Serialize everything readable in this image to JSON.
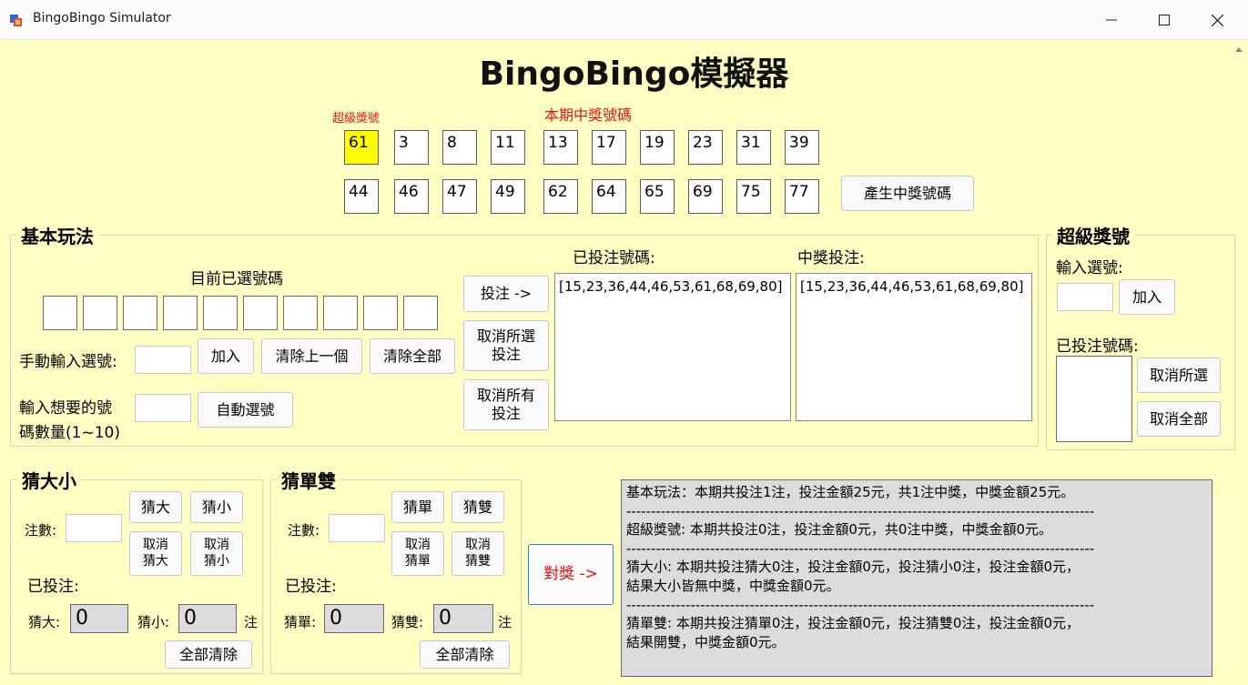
{
  "window": {
    "title": "BingoBingo Simulator"
  },
  "heading": "BingoBingo模擬器",
  "draw": {
    "super_label": "超級獎號",
    "winning_label": "本期中獎號碼",
    "super_number": "61",
    "row1": [
      "3",
      "8",
      "11",
      "13",
      "17",
      "19",
      "23",
      "31",
      "39"
    ],
    "row2": [
      "44",
      "46",
      "47",
      "49",
      "62",
      "64",
      "65",
      "69",
      "75",
      "77"
    ],
    "generate_button": "產生中獎號碼"
  },
  "basic": {
    "group_label": "基本玩法",
    "selected_label": "目前已選號碼",
    "manual_label": "手動輸入選號:",
    "add_button": "加入",
    "clear_last_button": "清除上一個",
    "clear_all_button": "清除全部",
    "count_label_line1": "輸入想要的號",
    "count_label_line2": "碼數量(1~10)",
    "auto_button": "自動選號",
    "bet_button": "投注 ->",
    "cancel_selected_line1": "取消所選",
    "cancel_selected_line2": "投注",
    "cancel_all_line1": "取消所有",
    "cancel_all_line2": "投注",
    "placed_label": "已投注號碼:",
    "placed_item": "[15,23,36,44,46,53,61,68,69,80]",
    "winning_bets_label": "中獎投注:",
    "winning_item": "[15,23,36,44,46,53,61,68,69,80]"
  },
  "super": {
    "group_label": "超級獎號",
    "input_label": "輸入選號:",
    "add_button": "加入",
    "placed_label": "已投注號碼:",
    "cancel_selected_button": "取消所選",
    "cancel_all_button": "取消全部"
  },
  "bigsmall": {
    "group_label": "猜大小",
    "count_label": "注數:",
    "big_button": "猜大",
    "small_button": "猜小",
    "cancel_big_line1": "取消",
    "cancel_big_line2": "猜大",
    "cancel_small_line1": "取消",
    "cancel_small_line2": "猜小",
    "placed_label": "已投注:",
    "big_label": "猜大:",
    "big_value": "0",
    "small_label": "猜小:",
    "small_value": "0",
    "unit": "注",
    "clear_all_button": "全部清除"
  },
  "oddeven": {
    "group_label": "猜單雙",
    "count_label": "注數:",
    "odd_button": "猜單",
    "even_button": "猜雙",
    "cancel_odd_line1": "取消",
    "cancel_odd_line2": "猜單",
    "cancel_even_line1": "取消",
    "cancel_even_line2": "猜雙",
    "placed_label": "已投注:",
    "odd_label": "猜單:",
    "odd_value": "0",
    "even_label": "猜雙:",
    "even_value": "0",
    "unit": "注",
    "clear_all_button": "全部清除"
  },
  "check_button": "對獎 ->",
  "result": {
    "line1": "基本玩法：本期共投注1注，投注金額25元，共1注中獎，中獎金額25元。",
    "sep1": "-----------------------------------------------------------------------------------------------",
    "line2": "超級獎號: 本期共投注0注，投注金額0元，共0注中獎，中獎金額0元。",
    "sep2": "-----------------------------------------------------------------------------------------------",
    "line3": "猜大小: 本期共投注猜大0注，投注金額0元，投注猜小0注，投注金額0元，",
    "line4": "結果大小皆無中獎，中獎金額0元。",
    "sep3": "-----------------------------------------------------------------------------------------------",
    "line5": "猜單雙: 本期共投注猜單0注，投注金額0元，投注猜雙0注，投注金額0元，",
    "line6": "結果開雙，中獎金額0元。"
  }
}
